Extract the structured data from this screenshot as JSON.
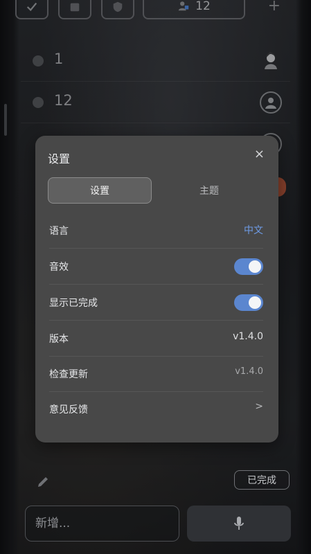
{
  "background": {
    "team_count": "12",
    "rows": [
      {
        "label": "1"
      },
      {
        "label": "12"
      }
    ]
  },
  "settings_modal": {
    "title": "设置",
    "close_label": "×",
    "tabs": [
      {
        "label": "设置",
        "active": true
      },
      {
        "label": "主题",
        "active": false
      }
    ],
    "items": [
      {
        "label": "语言",
        "value": "中文",
        "type": "link"
      },
      {
        "label": "音效",
        "type": "toggle",
        "on": true
      },
      {
        "label": "显示已完成",
        "type": "toggle",
        "on": true
      },
      {
        "label": "版本",
        "value": "v1.4.0",
        "type": "text"
      },
      {
        "label": "检查更新",
        "value": "v1.4.0",
        "type": "muted"
      },
      {
        "label": "意见反馈",
        "value": ">",
        "type": "chevron"
      }
    ]
  },
  "bottom_bar": {
    "done_label": "已完成",
    "input_placeholder": "新增..."
  },
  "colors": {
    "accent": "#5b86cf",
    "link": "#6e9be6",
    "modal_bg": "#484848"
  },
  "icons": {
    "top_toolbar": [
      "check-icon",
      "calendar-icon",
      "shield-icon",
      "team-icon",
      "plus-icon"
    ],
    "bottom": [
      "pencil-icon",
      "microphone-icon"
    ]
  }
}
